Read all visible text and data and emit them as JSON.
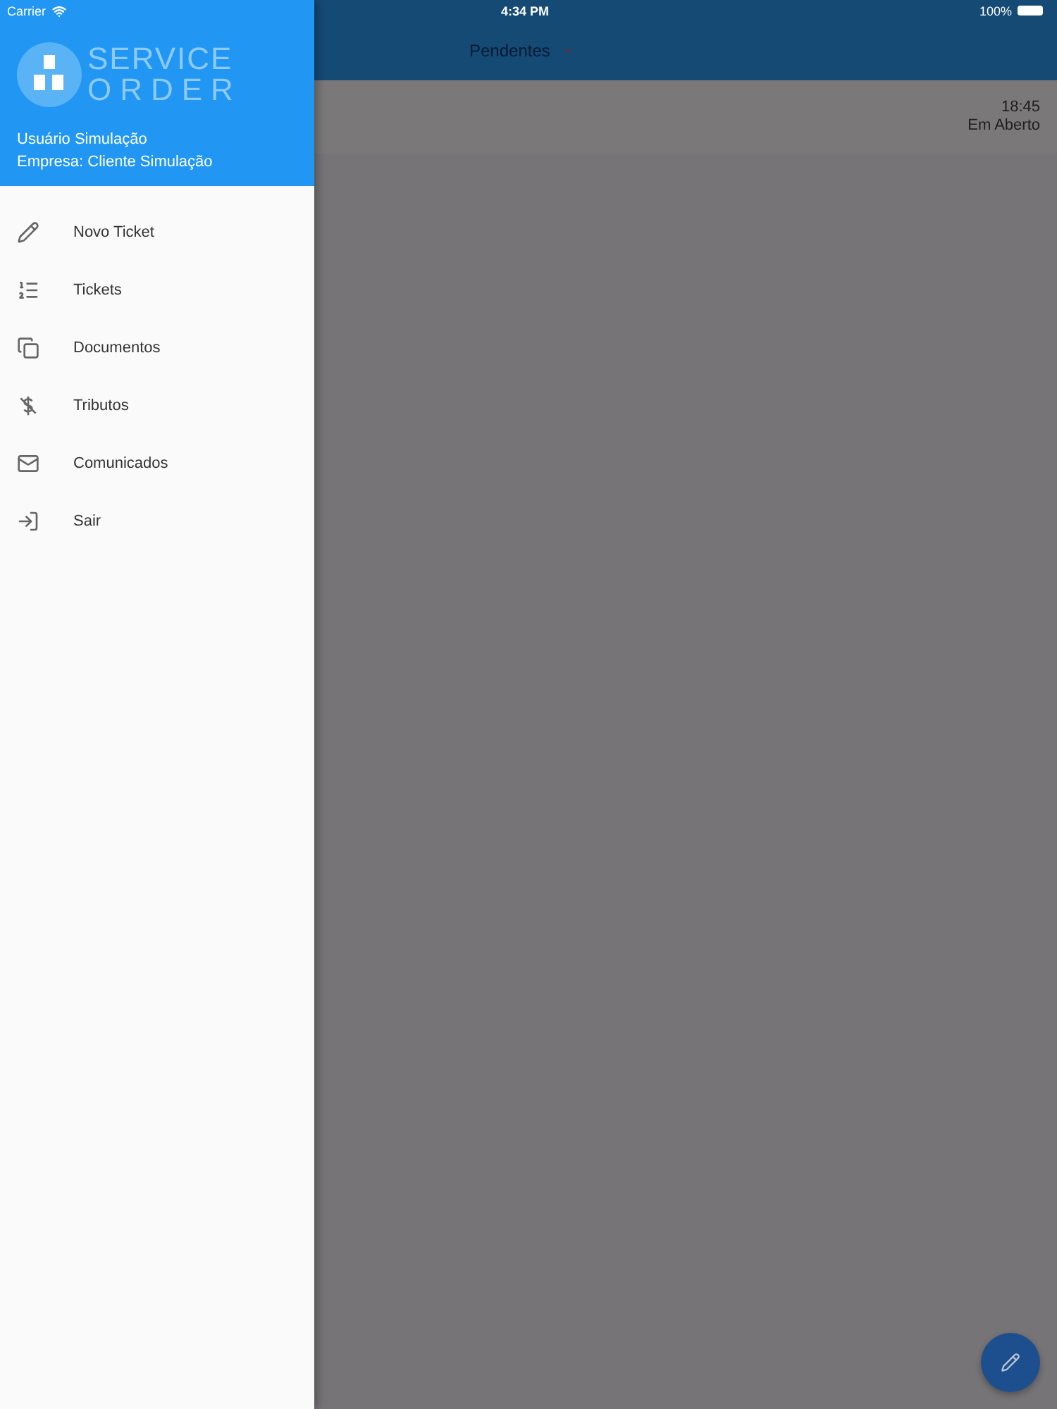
{
  "status_bar": {
    "carrier": "Carrier",
    "time": "4:34 PM",
    "battery": "100%"
  },
  "drawer": {
    "logo": {
      "line_1": "SERVICE",
      "line_2": "ORDER"
    },
    "user": "Usuário Simulação",
    "company": "Empresa: Cliente Simulação",
    "items": [
      {
        "label": "Novo Ticket"
      },
      {
        "label": "Tickets"
      },
      {
        "label": "Documentos"
      },
      {
        "label": "Tributos"
      },
      {
        "label": "Comunicados"
      },
      {
        "label": "Sair"
      }
    ]
  },
  "app_bar": {
    "filter": "Pendentes"
  },
  "tickets": [
    {
      "time": "18:45",
      "status": "Em Aberto"
    }
  ]
}
